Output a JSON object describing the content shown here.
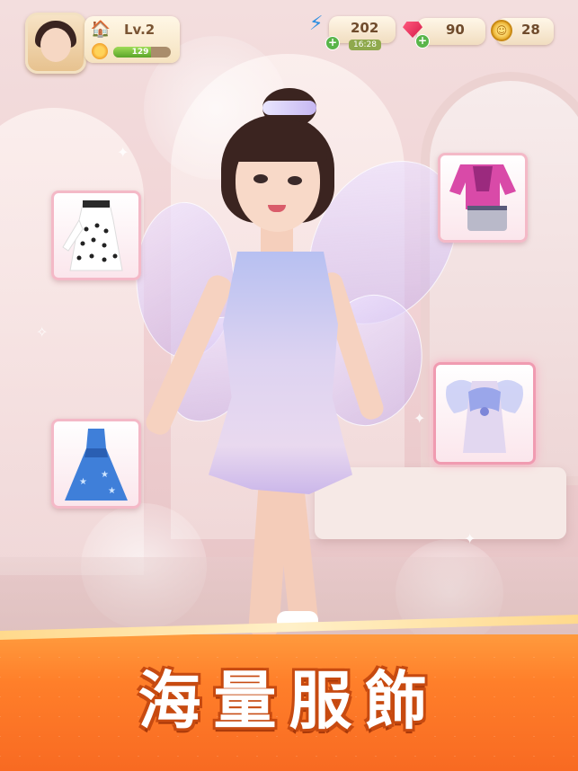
{
  "hud": {
    "level_label": "Lv.2",
    "xp_value": "129",
    "xp_fraction": 0.65,
    "energy_value": "202",
    "energy_timer": "16:28",
    "gems_value": "90",
    "coins_value": "28"
  },
  "banner": {
    "title": "海量服飾"
  },
  "colors": {
    "banner_orange": "#ff7f2a",
    "card_border": "#f4b9c7",
    "hud_panel": "#f5e2bf"
  },
  "outfits": [
    {
      "id": "polka-dot-dress"
    },
    {
      "id": "pink-jacket-outfit"
    },
    {
      "id": "fairy-wing-dress"
    },
    {
      "id": "blue-star-gown"
    }
  ]
}
